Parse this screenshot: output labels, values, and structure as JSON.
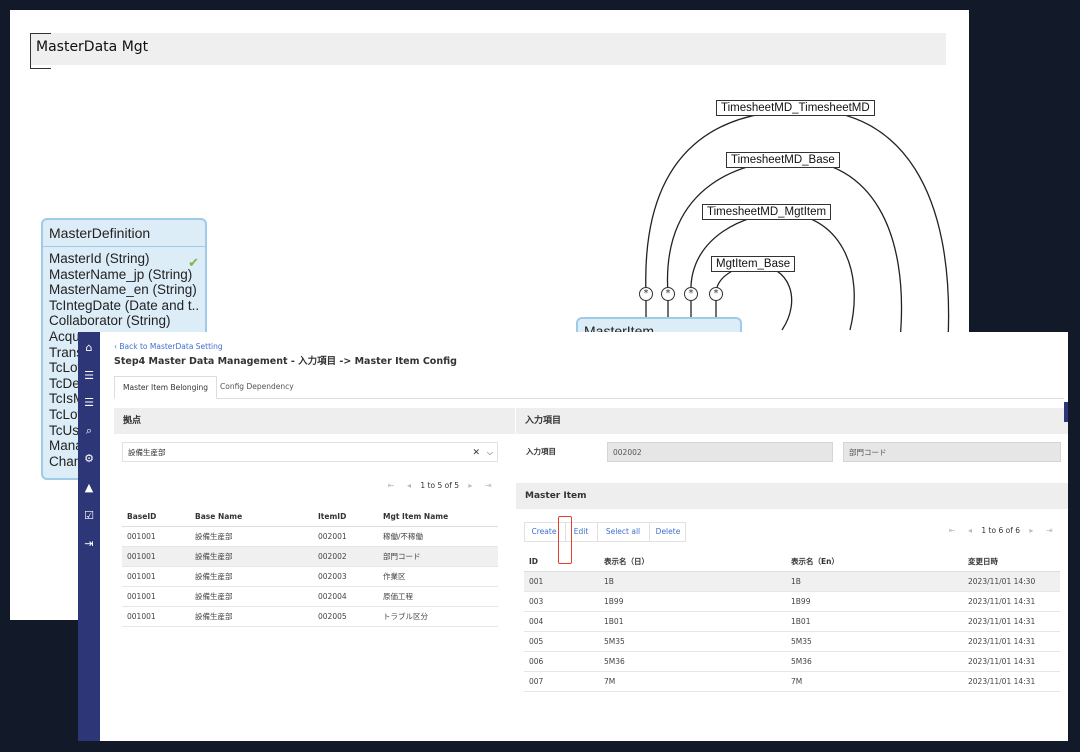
{
  "back_window": {
    "title": "MasterData Mgt",
    "master_definition": {
      "title": "MasterDefinition",
      "fields": [
        "MasterId (String)",
        "MasterName_jp (String)",
        "MasterName_en (String)",
        "TcIntegDate (Date and t...",
        "Collaborator (String)",
        "Acqu",
        "Trans",
        "TcLov",
        "TcDe",
        "TcIsM",
        "TcLov",
        "TcUse",
        "Mana",
        "Chan"
      ]
    },
    "master_item_box": {
      "title": "MasterItem"
    },
    "nodes": [
      "TimesheetMD_TimesheetMD",
      "TimesheetMD_Base",
      "TimesheetMD_MgtItem",
      "MgtItem_Base"
    ],
    "star_symbol": "*",
    "check_symbol": "✔"
  },
  "front_window": {
    "back_link": "Back to MasterData Setting",
    "heading": "Step4 Master Data Management - 入力項目 -> Master Item Config",
    "tabs": [
      "Master Item Belonging",
      "Config Dependency"
    ],
    "left_panel": {
      "title": "拠点",
      "select_value": "設備生産部",
      "clear_icon": "✕",
      "chevron": "⌵",
      "pager_text": "1 to 5 of 5",
      "columns": [
        "BaseID",
        "Base Name",
        "ItemID",
        "Mgt Item Name"
      ],
      "rows": [
        [
          "001001",
          "設備生産部",
          "002001",
          "稼働/不稼働"
        ],
        [
          "001001",
          "設備生産部",
          "002002",
          "部門コード"
        ],
        [
          "001001",
          "設備生産部",
          "002003",
          "作業区"
        ],
        [
          "001001",
          "設備生産部",
          "002004",
          "原価工程"
        ],
        [
          "001001",
          "設備生産部",
          "002005",
          "トラブル区分"
        ]
      ],
      "highlight_row": 1
    },
    "right_panel": {
      "title": "入力項目",
      "input_label": "入力項目",
      "input_code": "002002",
      "input_name": "部門コード",
      "master_item_title": "Master Item",
      "actions": [
        "Create",
        "Edit",
        "Select all",
        "Delete"
      ],
      "pager_text": "1 to 6 of 6",
      "columns": [
        "ID",
        "表示名（日）",
        "表示名（En）",
        "変更日時"
      ],
      "rows": [
        [
          "001",
          "1B",
          "1B",
          "2023/11/01 14:30"
        ],
        [
          "003",
          "1B99",
          "1B99",
          "2023/11/01 14:31"
        ],
        [
          "004",
          "1B01",
          "1B01",
          "2023/11/01 14:31"
        ],
        [
          "005",
          "5M35",
          "5M35",
          "2023/11/01 14:31"
        ],
        [
          "006",
          "5M36",
          "5M36",
          "2023/11/01 14:31"
        ],
        [
          "007",
          "7M",
          "7M",
          "2023/11/01 14:31"
        ]
      ],
      "highlight_row": 0
    },
    "nav_icons": [
      "home-icon",
      "list-icon",
      "list-icon",
      "search-icon",
      "gear-icon",
      "bell-icon",
      "checkbox-icon",
      "logout-icon"
    ],
    "colors": {
      "nav_rail": "#2d3777",
      "link": "#3f6fcf",
      "highlight_box": "#e0402c",
      "entity_fill": "#dcedf8"
    }
  }
}
